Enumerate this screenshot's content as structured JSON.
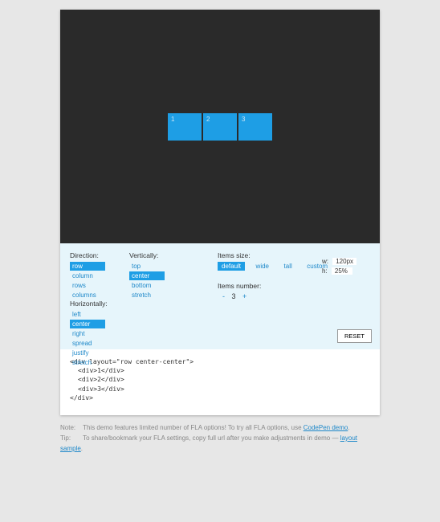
{
  "stage": {
    "items": [
      "1",
      "2",
      "3"
    ]
  },
  "direction": {
    "heading": "Direction:",
    "options": [
      "row",
      "column",
      "rows",
      "columns"
    ],
    "selected": "row"
  },
  "vertical": {
    "heading": "Vertically:",
    "options": [
      "top",
      "center",
      "bottom",
      "stretch"
    ],
    "selected": "center"
  },
  "horizontal": {
    "heading": "Horizontally:",
    "options": [
      "left",
      "center",
      "right",
      "spread",
      "justify",
      "stretch"
    ],
    "selected": "center"
  },
  "size": {
    "heading": "Items size:",
    "options": [
      "default",
      "wide",
      "tall",
      "custom"
    ],
    "selected": "default"
  },
  "wh": {
    "w_label": "w:",
    "w_value": "120px",
    "h_label": "h:",
    "h_value": "25%"
  },
  "number": {
    "heading": "Items number:",
    "value": "3",
    "minus": "-",
    "plus": "+"
  },
  "reset": "RESET",
  "code": {
    "line1": "<div layout=\"row center-center\">",
    "line2": "<div>1</div>",
    "line3": "<div>2</div>",
    "line4": "<div>3</div>",
    "line5": "</div>"
  },
  "notes": {
    "note_label": "Note:",
    "note_text": "This demo features limited number of FLA options! To try all FLA options, use ",
    "note_link": "CodePen demo",
    "tip_label": "Tip:",
    "tip_text": "To share/bookmark your FLA settings, copy full url after you make adjustments in demo — ",
    "tip_link": "layout sample"
  }
}
